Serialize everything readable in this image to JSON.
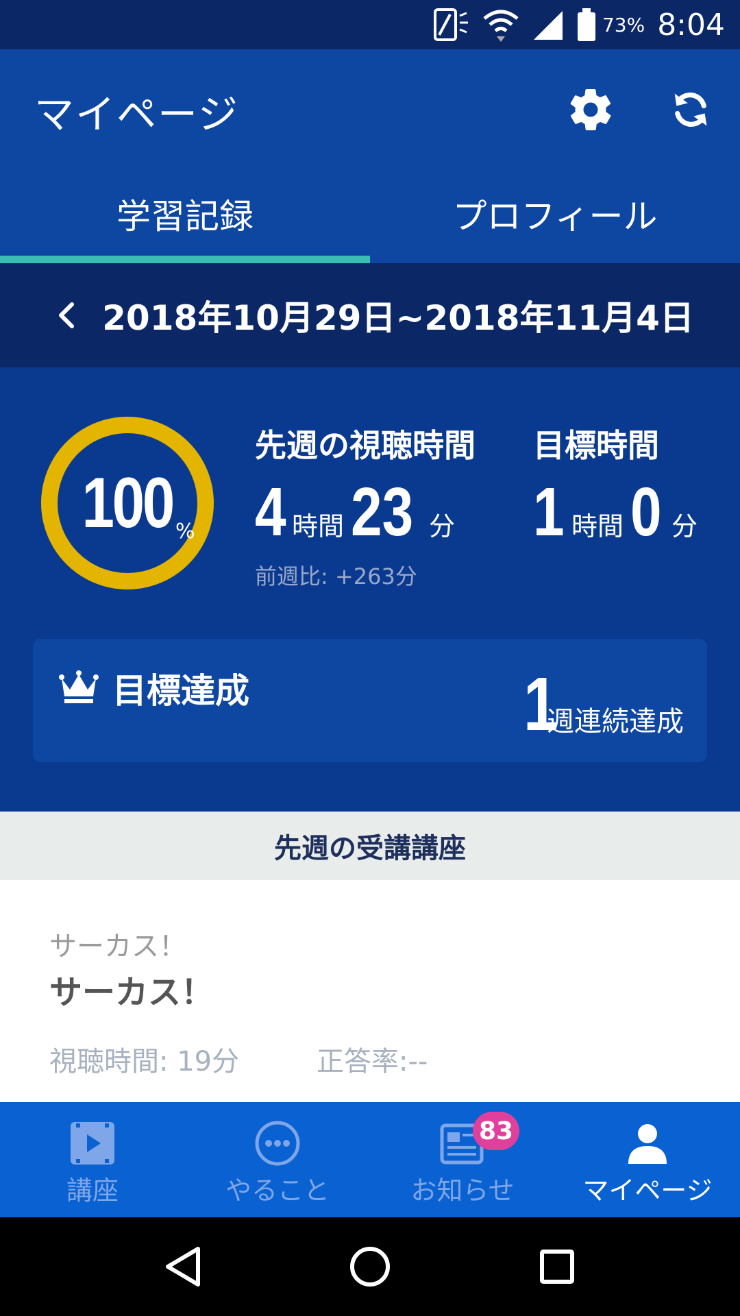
{
  "status_bar": {
    "battery": "73%",
    "time": "8:04"
  },
  "header": {
    "title": "マイページ"
  },
  "tabs": [
    {
      "label": "学習記録",
      "active": true
    },
    {
      "label": "プロフィール",
      "active": false
    }
  ],
  "week": {
    "range": "2018年10月29日~2018年11月4日"
  },
  "progress": {
    "value": "100",
    "unit": "%",
    "fraction": 1.0
  },
  "last_week": {
    "label": "先週の視聴時間",
    "hours": "4",
    "hours_unit": "時間",
    "minutes": "23",
    "minutes_unit": "分",
    "compare": "前週比: +263分"
  },
  "goal": {
    "label": "目標時間",
    "hours": "1",
    "hours_unit": "時間",
    "minutes": "0",
    "minutes_unit": "分"
  },
  "achievement": {
    "label": "目標達成",
    "count": "1",
    "unit": "週連続達成"
  },
  "courses": {
    "header": "先週の受講講座",
    "items": [
      {
        "subtitle": "サーカス！",
        "title": "サーカス！",
        "watch_time": "視聴時間: 19分",
        "correct_rate": "正答率:--"
      }
    ]
  },
  "bottom_nav": [
    {
      "label": "講座",
      "icon": "video-icon",
      "active": false
    },
    {
      "label": "やること",
      "icon": "more-dots-icon",
      "active": false
    },
    {
      "label": "お知らせ",
      "icon": "news-icon",
      "active": false,
      "badge": "83"
    },
    {
      "label": "マイページ",
      "icon": "person-icon",
      "active": true
    }
  ],
  "colors": {
    "primary": "#0e47a1",
    "dark": "#0b2766",
    "accent": "#37bfb4",
    "ring": "#e4b500",
    "nav": "#0a61d1",
    "badge": "#e0409c"
  }
}
